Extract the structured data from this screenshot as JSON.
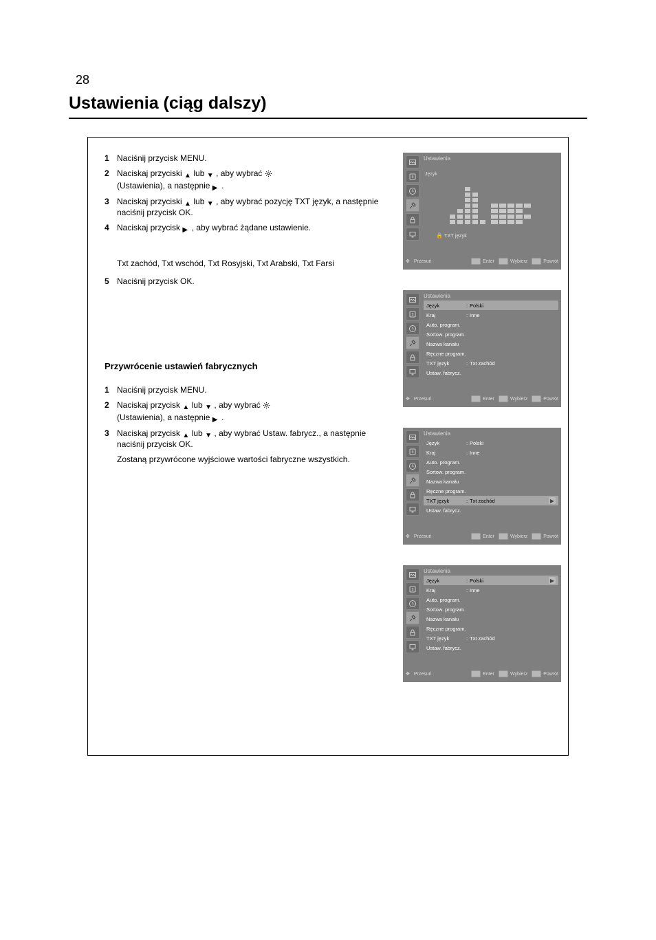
{
  "page_number_top": "28",
  "heading": "Ustawienia (ciąg dalszy)",
  "step1": {
    "num": "1",
    "text": "Naciśnij przycisk MENU."
  },
  "step2": {
    "num": "2",
    "line1_a": "Naciskaj przyciski ",
    "line1_b": " lub ",
    "line1_c": ", aby wybrać ",
    "line1_d_icon": "(Ustawienia), a następnie ",
    "line1_e": "."
  },
  "step3": {
    "num": "3",
    "line_a": "Naciskaj przyciski ",
    "line_b": " lub ",
    "line_c": ", aby wybrać pozycję TXT język, a następnie naciśnij przycisk OK."
  },
  "step4": {
    "num": "4",
    "line_a": "Naciskaj przycisk ",
    "line_b": ", aby wybrać żądane ustawienie."
  },
  "option_list": "Txt zachód, Txt wschód, Txt Rosyjski, Txt Arabski, Txt Farsi",
  "step5": {
    "num": "5",
    "text": "Naciśnij przycisk OK."
  },
  "subheading": "Przywrócenie ustawień fabrycznych",
  "step6": {
    "num": "1",
    "text": "Naciśnij przycisk MENU."
  },
  "step7": {
    "num": "2",
    "line_a": "Naciskaj przycisk ",
    "line_b": " lub ",
    "line_c": ", aby wybrać ",
    "line_d_icon": "(Ustawienia), a następnie ",
    "line_e": "."
  },
  "step8": {
    "num": "3",
    "line_a": "Naciskaj przycisk ",
    "line_b": " lub ",
    "line_c": ", aby wybrać Ustaw. fabrycz., a następnie naciśnij przycisk OK.",
    "note": "Zostaną przywrócone wyjściowe wartości fabryczne wszystkich."
  },
  "osd": {
    "title_setup": "Ustawienia",
    "rows": {
      "language": {
        "label": "Język",
        "value": "Polski"
      },
      "country": {
        "label": "Kraj",
        "value": "Inne"
      },
      "auto_prog": {
        "label": "Auto. program.",
        "value": ""
      },
      "sort_prog": {
        "label": "Sortow. program.",
        "value": ""
      },
      "chan_name": {
        "label": "Nazwa kanału",
        "value": ""
      },
      "man_prog": {
        "label": "Ręczne program.",
        "value": ""
      },
      "txt_lang": {
        "label": "TXT język",
        "value": "Txt zachód"
      },
      "factory": {
        "label": "Ustaw. fabrycz.",
        "value": ""
      }
    },
    "footer": {
      "move": "Przesuń",
      "select": "Wybierz",
      "enter": "Enter",
      "return": "Powrót"
    },
    "eq_left_labels": [
      "Język",
      "Kraj",
      "Auto. program.",
      "Sortow. program.",
      "Nazwa kanału",
      "Ręczne program."
    ],
    "eq_sub": "TXT język",
    "eq_bottom": [
      "Sortow. program.",
      "TXT język"
    ]
  },
  "icons": {
    "picture": "picture-icon",
    "channel": "channel-icon",
    "clock": "clock-icon",
    "tools": "tools-icon",
    "lock": "lock-icon",
    "pc": "pc-icon",
    "move": "move-icon",
    "setup_gear": "setup-gear-icon"
  }
}
